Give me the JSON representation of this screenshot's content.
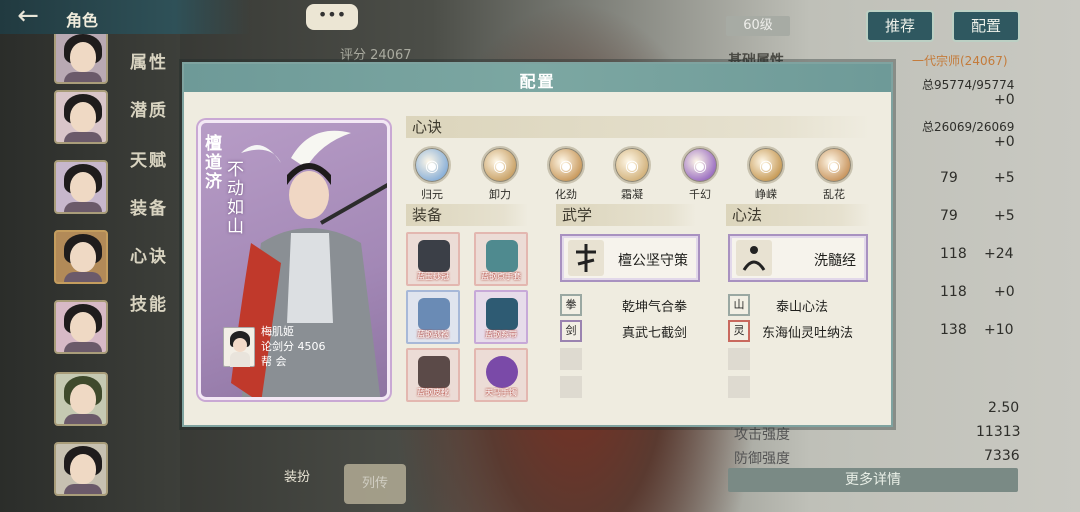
{
  "background": {
    "top_title": "角色",
    "back_icon": "back-arrow-icon",
    "chat_bubble": "•••",
    "tabs": [
      "属性",
      "潜质",
      "天赋",
      "装备",
      "心诀",
      "技能"
    ],
    "score": "评分 24067",
    "level": "60级",
    "buttons": {
      "recommend": "推荐",
      "config": "配置"
    },
    "basic_attr": "基础属性",
    "rank": "一代宗师(24067)",
    "hp": "总95774/95774",
    "hp_plus": "+0",
    "mp": "总26069/26069",
    "mp_plus": "+0",
    "stat_rows": [
      {
        "val": "79",
        "plus": "+5"
      },
      {
        "val": "79",
        "plus": "+5"
      },
      {
        "val": "118",
        "plus": "+24"
      },
      {
        "val": "118",
        "plus": "+0"
      },
      {
        "val": "138",
        "plus": "+10"
      }
    ],
    "value_250": "2.50",
    "attack_label": "攻击强度",
    "attack_val": "11313",
    "defense_label": "防御强度",
    "defense_val": "7336",
    "more_details": "更多详情",
    "outfit_label": "装扮",
    "bio_label": "列传"
  },
  "modal": {
    "title": "配置",
    "card": {
      "name": "檀道济",
      "title": "不动如山",
      "owner_name": "梅肌姬",
      "owner_score": "论剑分 4506",
      "owner_guild": "帮 会"
    },
    "xinjue": {
      "header": "心诀",
      "items": [
        {
          "label": "归元",
          "icon": "guiyuan-icon",
          "color": "#8ab0d8"
        },
        {
          "label": "卸力",
          "icon": "xieli-icon",
          "color": "#c9a268"
        },
        {
          "label": "化劲",
          "icon": "huajin-icon",
          "color": "#c99a5e"
        },
        {
          "label": "霜凝",
          "icon": "shuangning-icon",
          "color": "#d2b27c"
        },
        {
          "label": "千幻",
          "icon": "qianhuan-icon",
          "color": "#9b6fc2"
        },
        {
          "label": "峥嵘",
          "icon": "zhengrong-icon",
          "color": "#c79b58"
        },
        {
          "label": "乱花",
          "icon": "luanhua-icon",
          "color": "#c99660"
        }
      ]
    },
    "equipment": {
      "header": "装备",
      "items": [
        {
          "label": "蓝玉纱冠",
          "icon": "hood-icon",
          "grade": "red"
        },
        {
          "label": "蓝钢点手套",
          "icon": "gloves-icon",
          "grade": "red"
        },
        {
          "label": "蓝钢战袍",
          "icon": "robe-icon",
          "grade": "blue"
        },
        {
          "label": "蓝钢系带",
          "icon": "belt-icon",
          "grade": "purple"
        },
        {
          "label": "蓝钢皮靴",
          "icon": "boots-icon",
          "grade": "red"
        },
        {
          "label": "天马手镯",
          "icon": "bracelet-icon",
          "grade": "red"
        }
      ]
    },
    "wuxue": {
      "header": "武学",
      "main": "檀公坚守策",
      "subs": [
        "乾坤气合拳",
        "真武七截剑"
      ]
    },
    "xinfa": {
      "header": "心法",
      "main": "洗髓经",
      "subs": [
        "泰山心法",
        "东海仙灵吐纳法"
      ]
    }
  }
}
